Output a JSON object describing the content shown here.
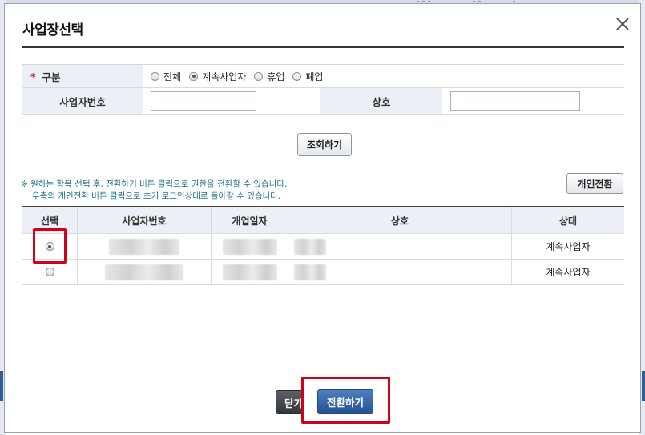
{
  "dialog": {
    "title": "사업장선택"
  },
  "form": {
    "category_label": "구분",
    "required_mark": "*",
    "options": [
      {
        "label": "전체",
        "selected": false
      },
      {
        "label": "계속사업자",
        "selected": true
      },
      {
        "label": "휴업",
        "selected": false
      },
      {
        "label": "폐업",
        "selected": false
      }
    ],
    "biz_no_label": "사업자번호",
    "biz_no_value": "",
    "company_label": "상호",
    "company_value": ""
  },
  "buttons": {
    "search": "조회하기",
    "personal": "개인전환",
    "close": "닫기",
    "switch": "전환하기"
  },
  "notice": {
    "line1": "※ 원하는 항목 선택 후, 전환하기 버튼 클릭으로 권한을 전환할 수 있습니다.",
    "line2": "우측의 개인전환 버튼 클릭으로 초기 로그인상태로 돌아갈 수 있습니다."
  },
  "grid": {
    "headers": [
      "선택",
      "사업자번호",
      "개업일자",
      "상호",
      "상태"
    ],
    "rows": [
      {
        "selected": true,
        "status": "계속사업자"
      },
      {
        "selected": false,
        "status": "계속사업자"
      }
    ]
  }
}
